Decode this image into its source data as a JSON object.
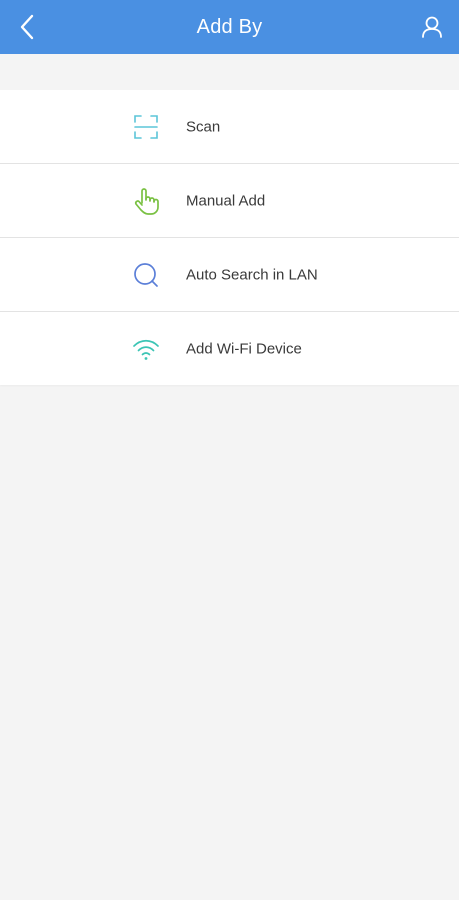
{
  "header": {
    "title": "Add By",
    "back_icon": "chevron-left-icon",
    "user_icon": "user-icon",
    "background": "#4a90e2"
  },
  "options": [
    {
      "label": "Scan",
      "icon": "scan-icon",
      "color": "#5bc5d8"
    },
    {
      "label": "Manual Add",
      "icon": "hand-pointer-icon",
      "color": "#7ac143"
    },
    {
      "label": "Auto Search in LAN",
      "icon": "search-icon",
      "color": "#5b7fd8"
    },
    {
      "label": "Add Wi-Fi Device",
      "icon": "wifi-icon",
      "color": "#3cc5b5"
    }
  ]
}
